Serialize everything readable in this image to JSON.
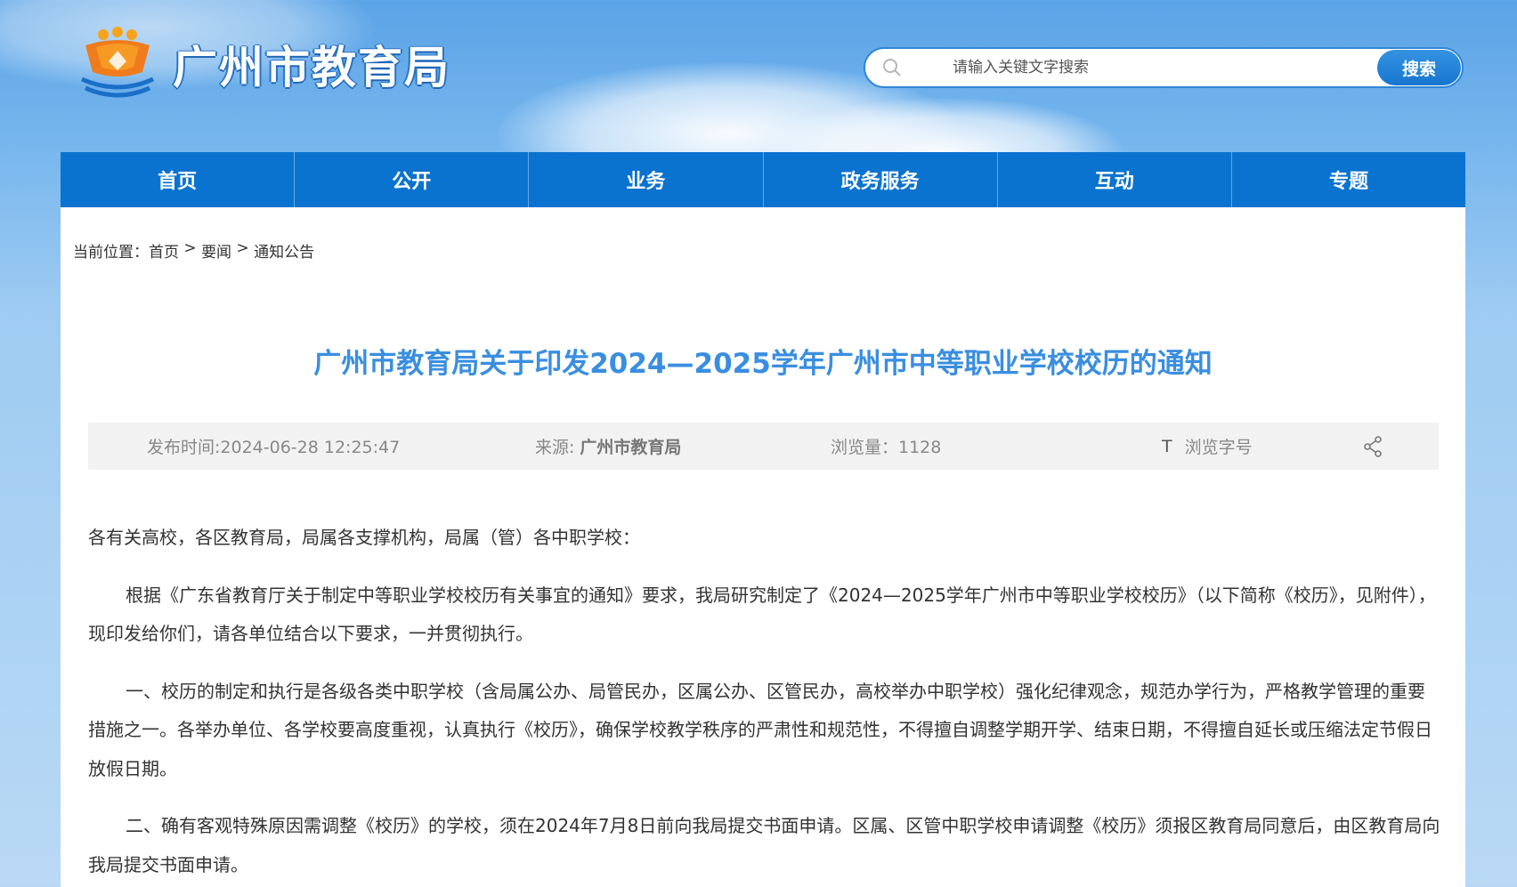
{
  "header": {
    "site_title": "广州市教育局",
    "search_placeholder": "请输入关键文字搜索",
    "search_button": "搜索"
  },
  "nav": [
    "首页",
    "公开",
    "业务",
    "政务服务",
    "互动",
    "专题"
  ],
  "breadcrumb": {
    "prefix": "当前位置：",
    "items": [
      "首页",
      "要闻",
      "通知公告"
    ],
    "separator": " > "
  },
  "article": {
    "title": "广州市教育局关于印发2024—2025学年广州市中等职业学校校历的通知",
    "meta": {
      "publish_time": "发布时间:2024-06-28 12:25:47",
      "source_label": "来源:",
      "source_value": "广州市教育局",
      "views": "浏览量：1128",
      "font_icon": "T",
      "font_label": "浏览字号"
    },
    "paragraphs": [
      "各有关高校，各区教育局，局属各支撑机构，局属（管）各中职学校：",
      "根据《广东省教育厅关于制定中等职业学校校历有关事宜的通知》要求，我局研究制定了《2024—2025学年广州市中等职业学校校历》（以下简称《校历》，见附件），现印发给你们，请各单位结合以下要求，一并贯彻执行。",
      "一、校历的制定和执行是各级各类中职学校（含局属公办、局管民办，区属公办、区管民办，高校举办中职学校）强化纪律观念，规范办学行为，严格教学管理的重要措施之一。各举办单位、各学校要高度重视，认真执行《校历》，确保学校教学秩序的严肃性和规范性，不得擅自调整学期开学、结束日期，不得擅自延长或压缩法定节假日放假日期。",
      "二、确有客观特殊原因需调整《校历》的学校，须在2024年7月8日前向我局提交书面申请。区属、区管中职学校申请调整《校历》须报区教育局同意后，由区教育局向我局提交书面申请。"
    ]
  },
  "colors": {
    "nav_bg": "#0a73cf",
    "title": "#3a8ee0",
    "meta_bg": "#f2f2f2"
  }
}
